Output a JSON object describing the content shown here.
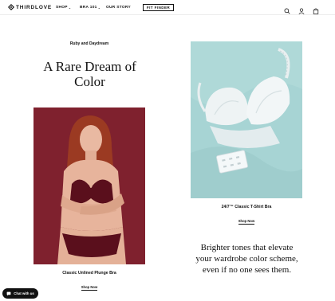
{
  "header": {
    "logo_text": "THIRDLOVE",
    "nav": [
      {
        "label": "SHOP"
      },
      {
        "label": "BRA 101"
      },
      {
        "label": "OUR STORY"
      }
    ],
    "fit_button": "FIT FINDER",
    "icons": [
      "search-icon",
      "account-icon",
      "bag-icon"
    ]
  },
  "main": {
    "eyebrow": "Ruby and Daydream",
    "headline_line1": "A Rare Dream of",
    "headline_line2": "Color",
    "products": [
      {
        "name": "Classic Unlined Plunge Bra",
        "cta": "Shop Now",
        "image_color": "#7a1f2b"
      },
      {
        "name": "24/7™ Classic T-Shirt Bra",
        "cta": "Shop Now",
        "image_color": "#a7d4d4"
      }
    ],
    "tagline_line1": "Brighter tones that elevate",
    "tagline_line2": "your wardrobe color scheme,",
    "tagline_line3": "even if no one sees them."
  },
  "chat": {
    "label": "Chat with us"
  },
  "colors": {
    "text": "#111111",
    "background": "#ffffff"
  }
}
